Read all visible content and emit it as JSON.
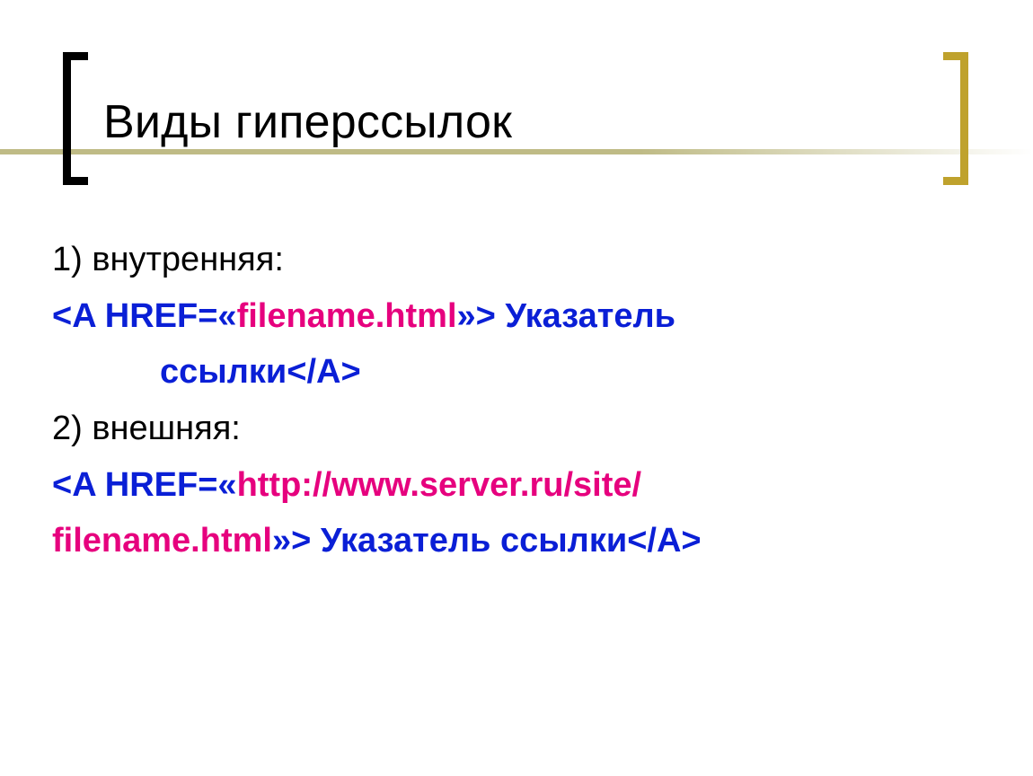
{
  "title": "Виды гиперссылок",
  "items": {
    "one_label": "1) внутренняя:",
    "one_code": {
      "open": "<A HREF=«",
      "file": "filename.html",
      "mid": "»> Указатель",
      "line2": "ссылки",
      "close": "</A>"
    },
    "two_label": "2) внешняя:",
    "two_code": {
      "open": "<A HREF=«",
      "url": "http://www.server.ru/site/",
      "file": "filename.html",
      "mid": "»> Указатель ссылки",
      "close": "</A>"
    }
  }
}
